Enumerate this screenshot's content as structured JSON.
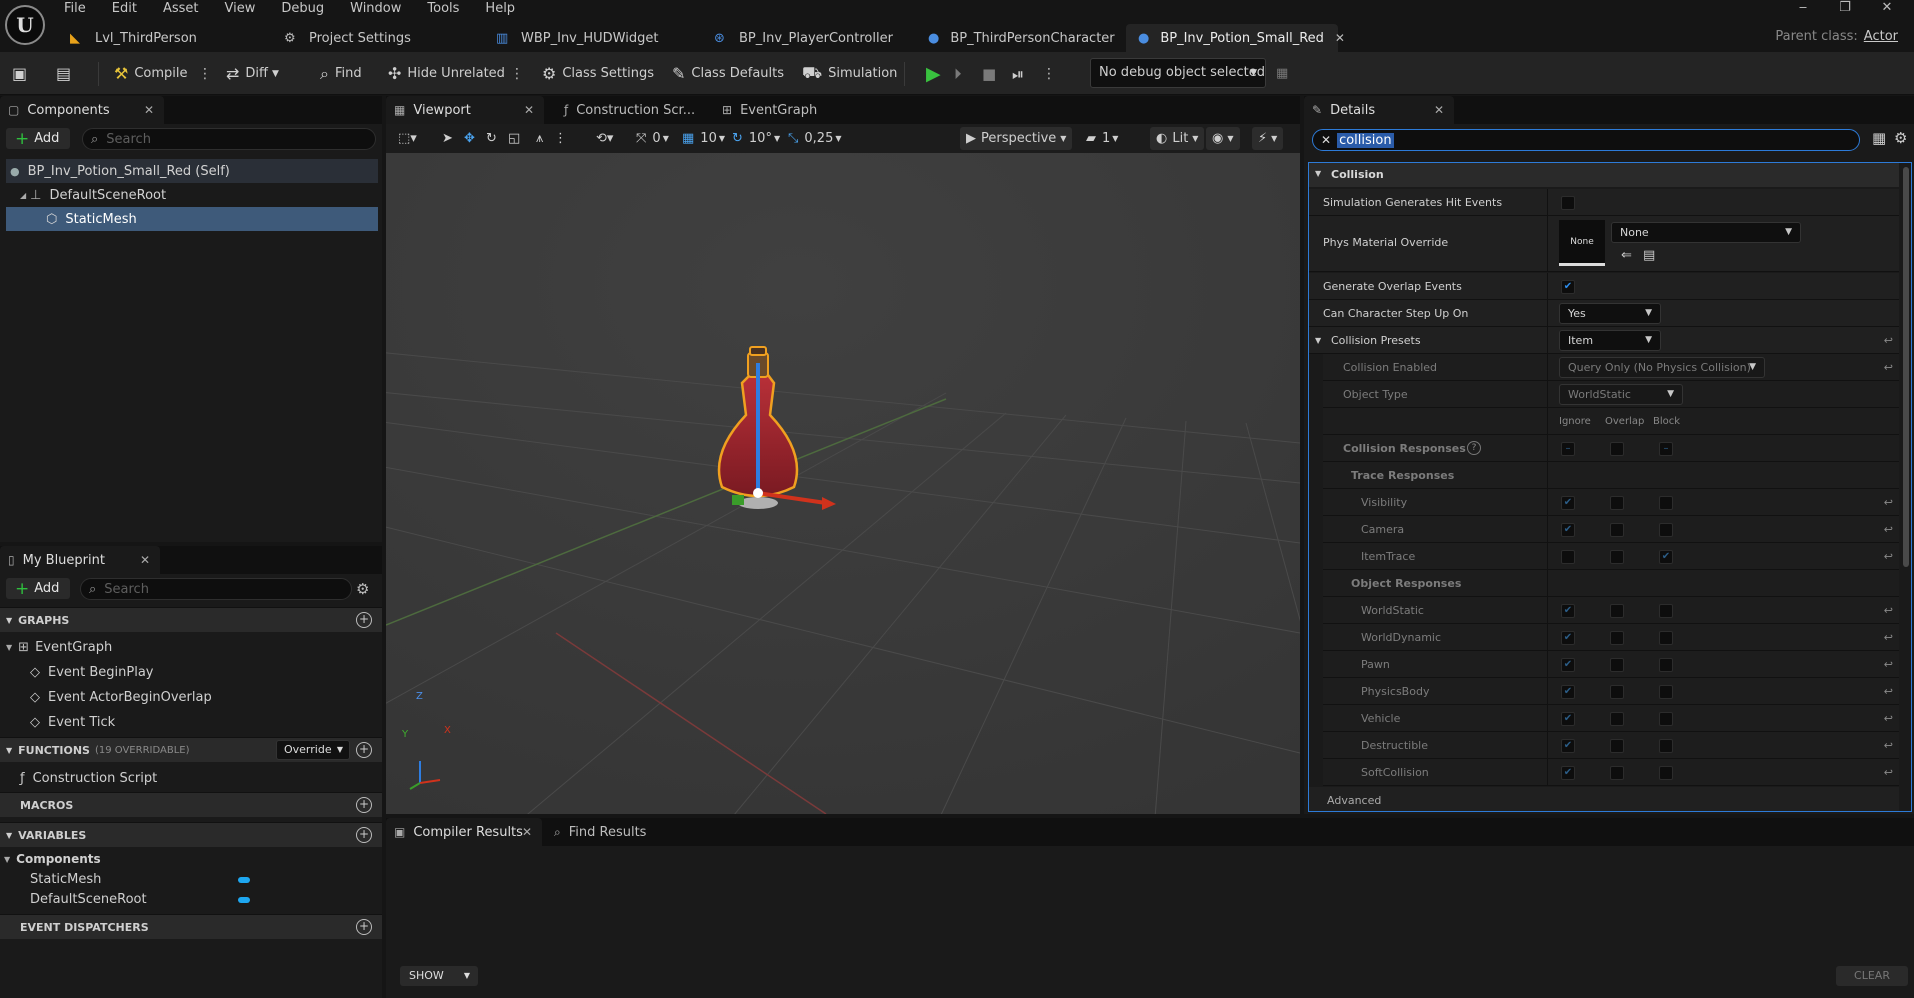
{
  "app": {
    "logo": "U",
    "menu": [
      "File",
      "Edit",
      "Asset",
      "View",
      "Debug",
      "Window",
      "Tools",
      "Help"
    ],
    "window_controls": [
      "‒",
      "❐",
      "✕"
    ],
    "doc_tabs": [
      {
        "label": "Lvl_ThirdPerson",
        "icon": "level-icon",
        "color": "#e8a21a"
      },
      {
        "label": "Project Settings",
        "icon": "settings-icon",
        "color": "#bbbbbb"
      },
      {
        "label": "WBP_Inv_HUDWidget",
        "icon": "widget-icon",
        "color": "#4a8de0"
      },
      {
        "label": "BP_Inv_PlayerController",
        "icon": "controller-icon",
        "color": "#4a8de0"
      },
      {
        "label": "BP_ThirdPersonCharacter",
        "icon": "character-icon",
        "color": "#4a8de0"
      },
      {
        "label": "BP_Inv_Potion_Small_Red",
        "icon": "blueprint-icon",
        "color": "#4a8de0",
        "active": true
      }
    ],
    "doc_tab_close": "✕",
    "parent_class_label": "Parent class:",
    "parent_class_value": "Actor"
  },
  "toolbar": {
    "compile": "Compile",
    "diff": "Diff",
    "find": "Find",
    "hide_unrelated": "Hide Unrelated",
    "class_settings": "Class Settings",
    "class_defaults": "Class Defaults",
    "simulation": "Simulation",
    "debug_select": "No debug object selected"
  },
  "components_panel": {
    "title": "Components",
    "add": "Add",
    "search_placeholder": "Search",
    "tree": [
      {
        "label": "BP_Inv_Potion_Small_Red (Self)",
        "level": 0
      },
      {
        "label": "DefaultSceneRoot",
        "level": 1
      },
      {
        "label": "StaticMesh",
        "level": 2,
        "selected": true
      }
    ]
  },
  "my_blueprint": {
    "title": "My Blueprint",
    "add": "Add",
    "search_placeholder": "Search",
    "graphs_header": "GRAPHS",
    "event_graph": "EventGraph",
    "events": [
      "Event BeginPlay",
      "Event ActorBeginOverlap",
      "Event Tick"
    ],
    "functions_header": "FUNCTIONS",
    "functions_count": "(19 OVERRIDABLE)",
    "override": "Override",
    "construction_script": "Construction Script",
    "macros_header": "MACROS",
    "variables_header": "VARIABLES",
    "components_group": "Components",
    "variables": [
      {
        "label": "StaticMesh",
        "color": "#1ea7f0"
      },
      {
        "label": "DefaultSceneRoot",
        "color": "#1ea7f0"
      }
    ],
    "dispatchers_header": "EVENT DISPATCHERS"
  },
  "editor_tabs": [
    {
      "label": "Viewport",
      "active": true
    },
    {
      "label": "Construction Scr..."
    },
    {
      "label": "EventGraph"
    }
  ],
  "viewport_toolbar": {
    "rotation_snap": "0",
    "grid": "10",
    "angle": "10°",
    "scale": "0,25",
    "perspective": "Perspective",
    "camera_speed": "1",
    "lit": "Lit"
  },
  "gizmo": {
    "z": "Z",
    "y": "Y",
    "x": "X"
  },
  "details": {
    "title": "Details",
    "search_value": "collision",
    "category": "Collision",
    "rows": [
      {
        "label": "Simulation Generates Hit Events",
        "type": "checkbox",
        "checked": false
      },
      {
        "label": "Phys Material Override",
        "type": "asset",
        "thumb": "None",
        "value": "None"
      },
      {
        "label": "Generate Overlap Events",
        "type": "checkbox",
        "checked": true
      },
      {
        "label": "Can Character Step Up On",
        "type": "dropdown",
        "value": "Yes"
      },
      {
        "label": "Collision Presets",
        "type": "dropdown",
        "value": "Item"
      },
      {
        "label": "Collision Enabled",
        "type": "dropdown",
        "value": "Query Only (No Physics Collision)"
      },
      {
        "label": "Object Type",
        "type": "dropdown",
        "value": "WorldStatic"
      }
    ],
    "response_headers": [
      "Ignore",
      "Overlap",
      "Block"
    ],
    "collision_responses": "Collision Responses",
    "trace_responses": "Trace Responses",
    "trace": [
      {
        "label": "Visibility",
        "value": "ignore"
      },
      {
        "label": "Camera",
        "value": "ignore"
      },
      {
        "label": "ItemTrace",
        "value": "block"
      }
    ],
    "object_responses": "Object Responses",
    "objects": [
      {
        "label": "WorldStatic",
        "value": "ignore"
      },
      {
        "label": "WorldDynamic",
        "value": "ignore"
      },
      {
        "label": "Pawn",
        "value": "ignore"
      },
      {
        "label": "PhysicsBody",
        "value": "ignore"
      },
      {
        "label": "Vehicle",
        "value": "ignore"
      },
      {
        "label": "Destructible",
        "value": "ignore"
      },
      {
        "label": "SoftCollision",
        "value": "ignore"
      }
    ],
    "advanced": "Advanced"
  },
  "bottom": {
    "compiler_results": "Compiler Results",
    "find_results": "Find Results",
    "show": "SHOW",
    "clear": "CLEAR"
  }
}
